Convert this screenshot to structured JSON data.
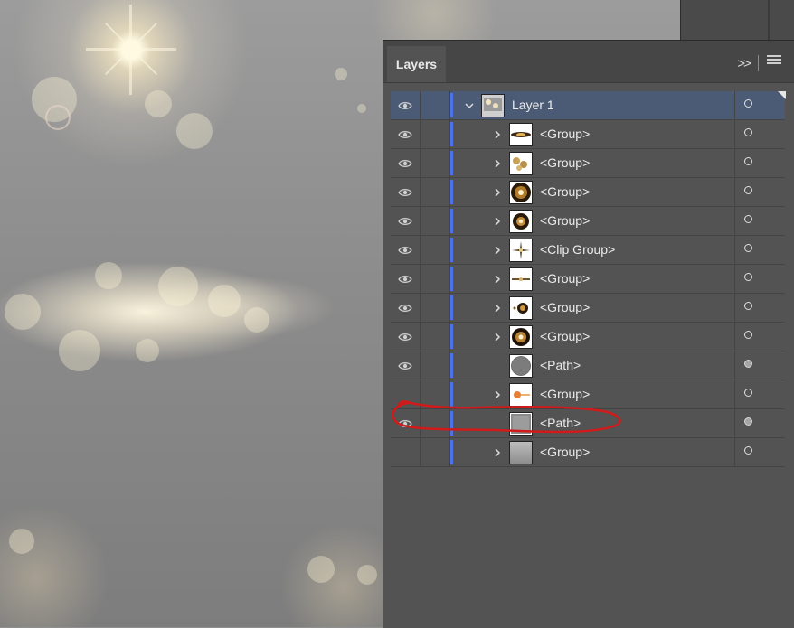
{
  "panel": {
    "tab_label": "Layers",
    "collapse_glyph": ">>",
    "selection_color": "#4b5b75",
    "layer_color": "#4f73e6"
  },
  "layers": [
    {
      "name": "Layer 1",
      "visible": true,
      "expanded": true,
      "level": 0,
      "thumb": "layer-thumb",
      "selected": true,
      "target_filled": false
    },
    {
      "name": "<Group>",
      "visible": true,
      "expandable": true,
      "level": 1,
      "thumb": "ellipse-flare",
      "target_filled": false
    },
    {
      "name": "<Group>",
      "visible": true,
      "expandable": true,
      "level": 1,
      "thumb": "bokeh-cluster",
      "target_filled": false
    },
    {
      "name": "<Group>",
      "visible": true,
      "expandable": true,
      "level": 1,
      "thumb": "glow-orb",
      "target_filled": false
    },
    {
      "name": "<Group>",
      "visible": true,
      "expandable": true,
      "level": 1,
      "thumb": "glow-orb-small",
      "target_filled": false
    },
    {
      "name": "<Clip Group>",
      "visible": true,
      "expandable": true,
      "level": 1,
      "thumb": "star-burst",
      "target_filled": false
    },
    {
      "name": "<Group>",
      "visible": true,
      "expandable": true,
      "level": 1,
      "thumb": "line-sparkle",
      "target_filled": false
    },
    {
      "name": "<Group>",
      "visible": true,
      "expandable": true,
      "level": 1,
      "thumb": "spark-dot",
      "target_filled": false
    },
    {
      "name": "<Group>",
      "visible": true,
      "expandable": true,
      "level": 1,
      "thumb": "burst-orb",
      "target_filled": false
    },
    {
      "name": "<Path>",
      "visible": true,
      "expandable": false,
      "level": 1,
      "thumb": "grey-circle",
      "target_filled": true
    },
    {
      "name": "<Group>",
      "visible": false,
      "expandable": true,
      "level": 1,
      "thumb": "orange-dot",
      "target_filled": false
    },
    {
      "name": "<Path>",
      "visible": true,
      "expandable": false,
      "level": 1,
      "thumb": "grey-square",
      "target_filled": true
    },
    {
      "name": "<Group>",
      "visible": false,
      "expandable": true,
      "level": 1,
      "thumb": "grey-gradient",
      "target_filled": false
    }
  ],
  "annotation_color": "#d11a1a"
}
